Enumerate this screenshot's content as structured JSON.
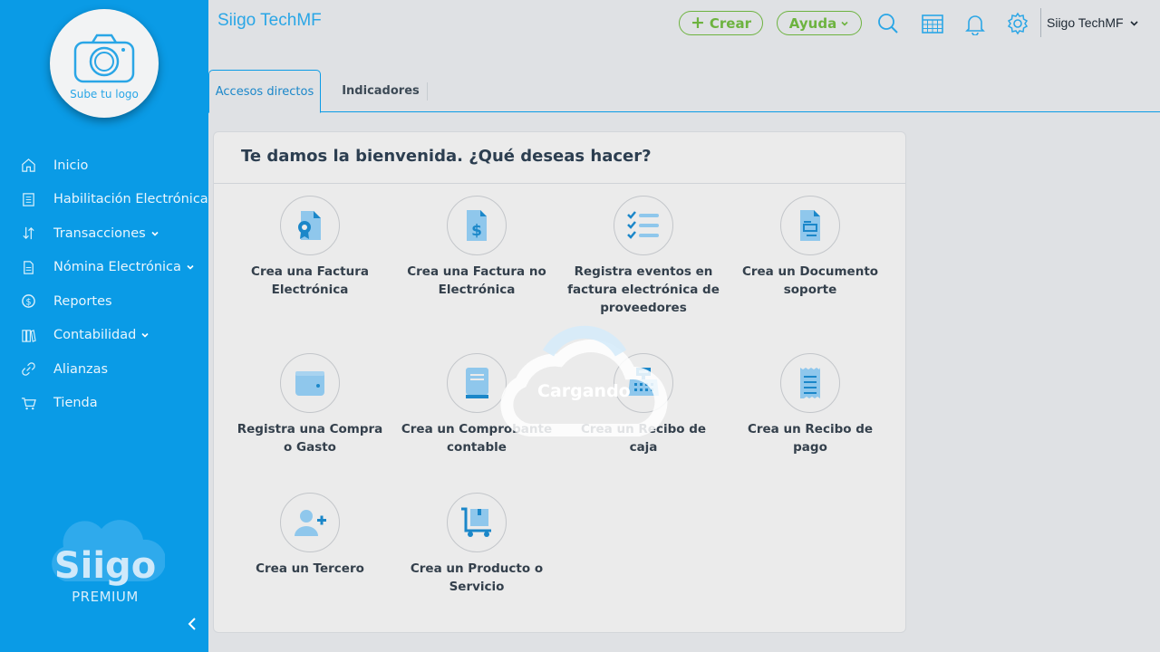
{
  "sidebar": {
    "logo_label": "Sube tu logo",
    "items": [
      {
        "label": "Inicio",
        "icon": "home-icon",
        "has_dropdown": false
      },
      {
        "label": "Habilitación Electrónica",
        "icon": "document-list-icon",
        "has_dropdown": false
      },
      {
        "label": "Transacciones",
        "icon": "transfer-icon",
        "has_dropdown": true
      },
      {
        "label": "Nómina Electrónica",
        "icon": "payroll-file-icon",
        "has_dropdown": true
      },
      {
        "label": "Reportes",
        "icon": "currency-coin-icon",
        "has_dropdown": false
      },
      {
        "label": "Contabilidad",
        "icon": "ledger-books-icon",
        "has_dropdown": true
      },
      {
        "label": "Alianzas",
        "icon": "link-icon",
        "has_dropdown": false
      },
      {
        "label": "Tienda",
        "icon": "shopping-cart-icon",
        "has_dropdown": false
      }
    ],
    "brand_name": "Siigo",
    "brand_sub": "PREMIUM"
  },
  "topbar": {
    "company": "Siigo TechMF",
    "crear_label": "Crear",
    "ayuda_label": "Ayuda",
    "user_name": "Siigo TechMF"
  },
  "tabs": [
    {
      "label": "Accesos directos",
      "active": true
    },
    {
      "label": "Indicadores",
      "active": false
    }
  ],
  "main": {
    "title": "Te damos la bienvenida. ¿Qué deseas hacer?",
    "actions": [
      {
        "label": "Crea una Factura Electrónica",
        "icon": "electronic-invoice-icon"
      },
      {
        "label": "Crea una Factura no Electrónica",
        "icon": "invoice-dollar-icon"
      },
      {
        "label": "Registra eventos en factura electrónica de proveedores",
        "icon": "checklist-icon"
      },
      {
        "label": "Crea un Documento soporte",
        "icon": "support-document-icon"
      },
      {
        "label": "Registra una Compra o Gasto",
        "icon": "wallet-icon"
      },
      {
        "label": "Crea un Comprobante contable",
        "icon": "accounting-book-icon"
      },
      {
        "label": "Crea un Recibo de caja",
        "icon": "cash-register-icon"
      },
      {
        "label": "Crea un Recibo de pago",
        "icon": "receipt-icon"
      },
      {
        "label": "Crea un Tercero",
        "icon": "add-user-icon"
      },
      {
        "label": "Crea un Producto o Servicio",
        "icon": "product-cart-icon"
      }
    ]
  },
  "loader": {
    "text": "Cargando"
  },
  "colors": {
    "sidebar": "#0a9be6",
    "accent_green": "#6db33f",
    "icon_blue": "#1b87c9",
    "icon_light": "#8fc7ec"
  }
}
